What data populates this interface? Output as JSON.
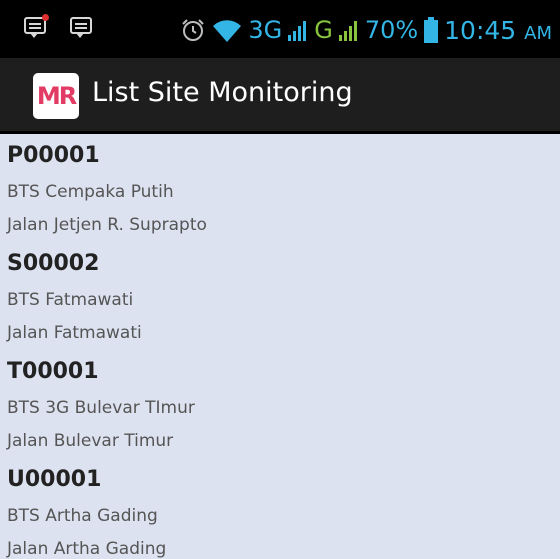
{
  "status_bar": {
    "network_3g": "3G",
    "network_g": "G",
    "battery": "70%",
    "time": "10:45",
    "ampm": "AM"
  },
  "action_bar": {
    "logo_text": "MR",
    "title": "List Site Monitoring"
  },
  "sites": [
    {
      "code": "P00001",
      "name": "BTS Cempaka Putih",
      "address": "Jalan Jetjen R. Suprapto"
    },
    {
      "code": "S00002",
      "name": "BTS Fatmawati",
      "address": "Jalan Fatmawati"
    },
    {
      "code": "T00001",
      "name": "BTS 3G Bulevar TImur",
      "address": "Jalan Bulevar Timur"
    },
    {
      "code": "U00001",
      "name": "BTS Artha Gading",
      "address": "Jalan Artha Gading"
    }
  ]
}
